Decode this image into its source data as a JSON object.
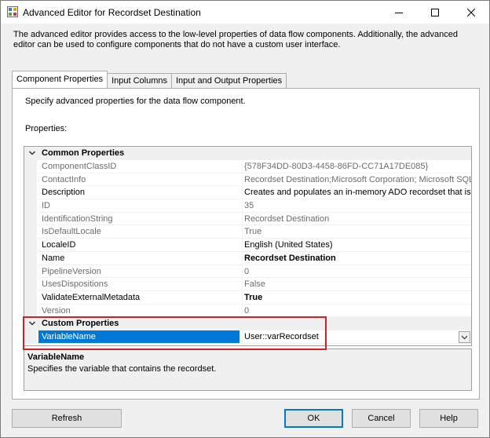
{
  "window": {
    "title": "Advanced Editor for Recordset Destination",
    "controls": {
      "minimize": "minimize",
      "maximize": "maximize",
      "close": "close"
    }
  },
  "intro_text": "The advanced editor provides access to the low-level properties of data flow components. Additionally, the advanced editor can be used to configure components that do not have a custom user interface.",
  "tabs": [
    {
      "label": "Component Properties",
      "active": true
    },
    {
      "label": "Input Columns",
      "active": false
    },
    {
      "label": "Input and Output Properties",
      "active": false
    }
  ],
  "panel": {
    "description": "Specify advanced properties for the data flow component.",
    "properties_label": "Properties:"
  },
  "grid": {
    "common_category": "Common Properties",
    "common": [
      {
        "name": "ComponentClassID",
        "value": "{578F34DD-80D3-4458-86FD-CC71A17DE085}",
        "readonly": true,
        "bold": false
      },
      {
        "name": "ContactInfo",
        "value": "Recordset Destination;Microsoft Corporation; Microsoft SQL Se",
        "readonly": true,
        "bold": false
      },
      {
        "name": "Description",
        "value": "Creates and populates an in-memory ADO recordset that is ava",
        "readonly": false,
        "bold": false
      },
      {
        "name": "ID",
        "value": "35",
        "readonly": true,
        "bold": false
      },
      {
        "name": "IdentificationString",
        "value": "Recordset Destination",
        "readonly": true,
        "bold": false
      },
      {
        "name": "IsDefaultLocale",
        "value": "True",
        "readonly": true,
        "bold": false
      },
      {
        "name": "LocaleID",
        "value": "English (United States)",
        "readonly": false,
        "bold": false
      },
      {
        "name": "Name",
        "value": "Recordset Destination",
        "readonly": false,
        "bold": true
      },
      {
        "name": "PipelineVersion",
        "value": "0",
        "readonly": true,
        "bold": false
      },
      {
        "name": "UsesDispositions",
        "value": "False",
        "readonly": true,
        "bold": false
      },
      {
        "name": "ValidateExternalMetadata",
        "value": "True",
        "readonly": false,
        "bold": true
      },
      {
        "name": "Version",
        "value": "0",
        "readonly": true,
        "bold": false
      }
    ],
    "custom_category": "Custom Properties",
    "custom": [
      {
        "name": "VariableName",
        "value": "User::varRecordset",
        "selected": true
      }
    ]
  },
  "help": {
    "title": "VariableName",
    "text": "Specifies the variable that contains the recordset."
  },
  "buttons": {
    "refresh": "Refresh",
    "ok": "OK",
    "cancel": "Cancel",
    "help": "Help"
  },
  "colors": {
    "selection": "#0078d7",
    "highlight_box": "#d11f26",
    "readonly_text": "#6d6d6d"
  }
}
